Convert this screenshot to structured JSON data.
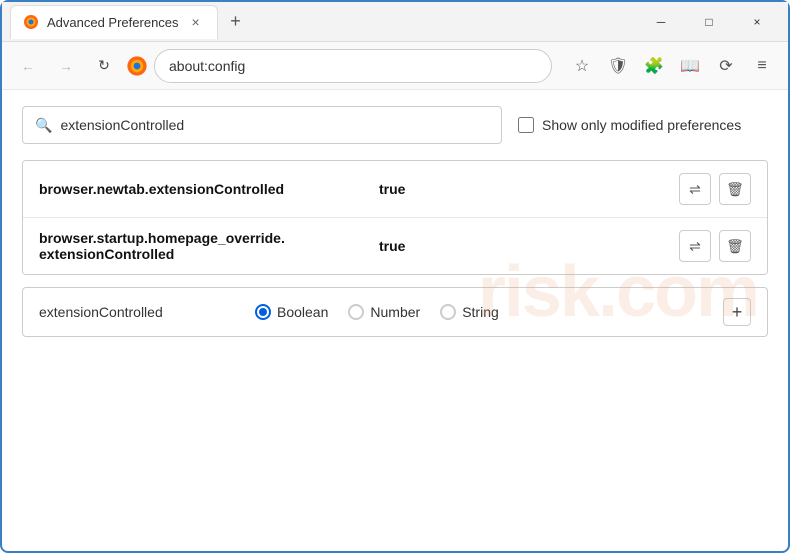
{
  "window": {
    "title": "Advanced Preferences",
    "tab_close": "×",
    "new_tab": "+",
    "controls": {
      "minimize": "─",
      "maximize": "□",
      "close": "×"
    }
  },
  "addressbar": {
    "back_label": "←",
    "forward_label": "→",
    "reload_label": "↻",
    "browser_name": "Firefox",
    "url": "about:config",
    "bookmark_icon": "☆",
    "shield_icon": "🛡",
    "extension_icon": "🧩",
    "pocket_icon": "📖",
    "sync_icon": "⟳",
    "menu_icon": "≡"
  },
  "search": {
    "placeholder": "extensionControlled",
    "value": "extensionControlled",
    "checkbox_label": "Show only modified preferences"
  },
  "results": [
    {
      "name": "browser.newtab.extensionControlled",
      "value": "true",
      "swap_icon": "⇌",
      "delete_icon": "🗑"
    },
    {
      "name": "browser.startup.homepage_override.\nextensionControlled",
      "name_line1": "browser.startup.homepage_override.",
      "name_line2": "extensionControlled",
      "value": "true",
      "swap_icon": "⇌",
      "delete_icon": "🗑"
    }
  ],
  "new_pref": {
    "name": "extensionControlled",
    "types": [
      {
        "label": "Boolean",
        "selected": true
      },
      {
        "label": "Number",
        "selected": false
      },
      {
        "label": "String",
        "selected": false
      }
    ],
    "add_label": "+"
  },
  "watermark": "risk.com"
}
